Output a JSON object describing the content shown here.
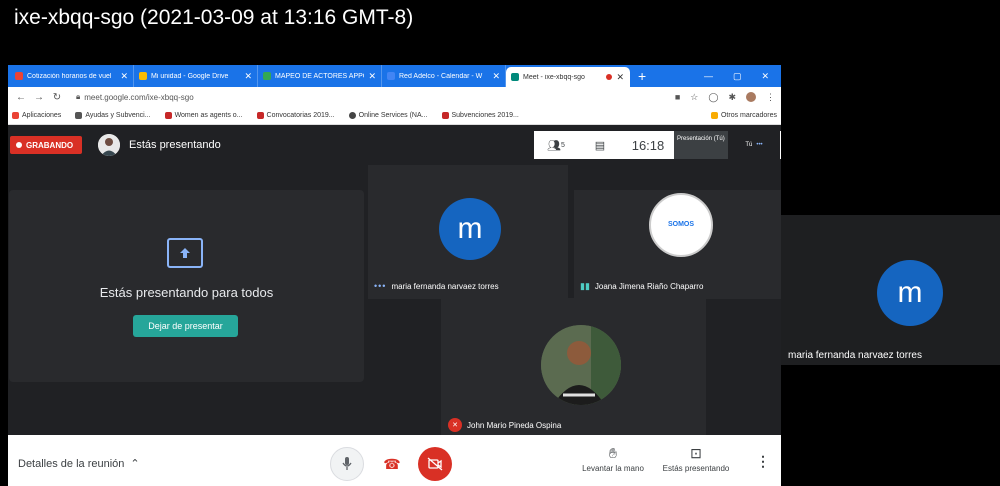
{
  "recording_title": "ixe-xbqq-sgo (2021-03-09 at 13:16 GMT-8)",
  "tabs": [
    {
      "label": "Cotización horarios de vuel",
      "color": "#ea4335",
      "active": false
    },
    {
      "label": "Mi unidad - Google Drive",
      "color": "#fbbc04",
      "active": false
    },
    {
      "label": "MAPEO DE ACTORES APPC",
      "color": "#34a853",
      "active": false
    },
    {
      "label": "Red Adelco - Calendar - W",
      "color": "#4285f4",
      "active": false
    },
    {
      "label": "Meet - ixe-xbqq-sgo",
      "color": "#00897b",
      "active": true
    }
  ],
  "tab_new": "+",
  "address": {
    "url": "meet.google.com/ixe-xbqq-sgo"
  },
  "bookmarks": [
    {
      "label": "Aplicaciones",
      "color": "#ea4335"
    },
    {
      "label": "Ayudas y Subvenci...",
      "color": "#555555"
    },
    {
      "label": "Women as agents o...",
      "color": "#c62828"
    },
    {
      "label": "Convocatorias 2019...",
      "color": "#c62828"
    },
    {
      "label": "Online Services (NA...",
      "color": "#444444"
    },
    {
      "label": "Subvenciones 2019...",
      "color": "#c62828"
    }
  ],
  "bookmarks_other": "Otros marcadores",
  "meet": {
    "recording_badge": "GRABANDO",
    "presenting_label": "Estás presentando",
    "participants_count": "5",
    "clock": "16:18",
    "presentation_tile": "Presentación (Tú)",
    "self_tile": "Tú",
    "presenting_card_text": "Estás presentando para todos",
    "stop_presenting": "Dejar de presentar",
    "participants": [
      {
        "name": "maria fernanda narvaez torres",
        "initial": "m"
      },
      {
        "name": "Joana Jimena Riaño Chaparro",
        "logo_text": "SOMOS"
      },
      {
        "name": "John Mario Pineda Ospina"
      }
    ],
    "meeting_details": "Detalles de la reunión",
    "raise_hand": "Levantar la mano",
    "now_presenting": "Estás presentando"
  },
  "side_tile": {
    "name": "maria fernanda narvaez torres",
    "initial": "m"
  },
  "colors": {
    "accent": "#1a73e8",
    "record": "#d93025",
    "teal": "#26a69a",
    "avatar": "#1565c0"
  }
}
